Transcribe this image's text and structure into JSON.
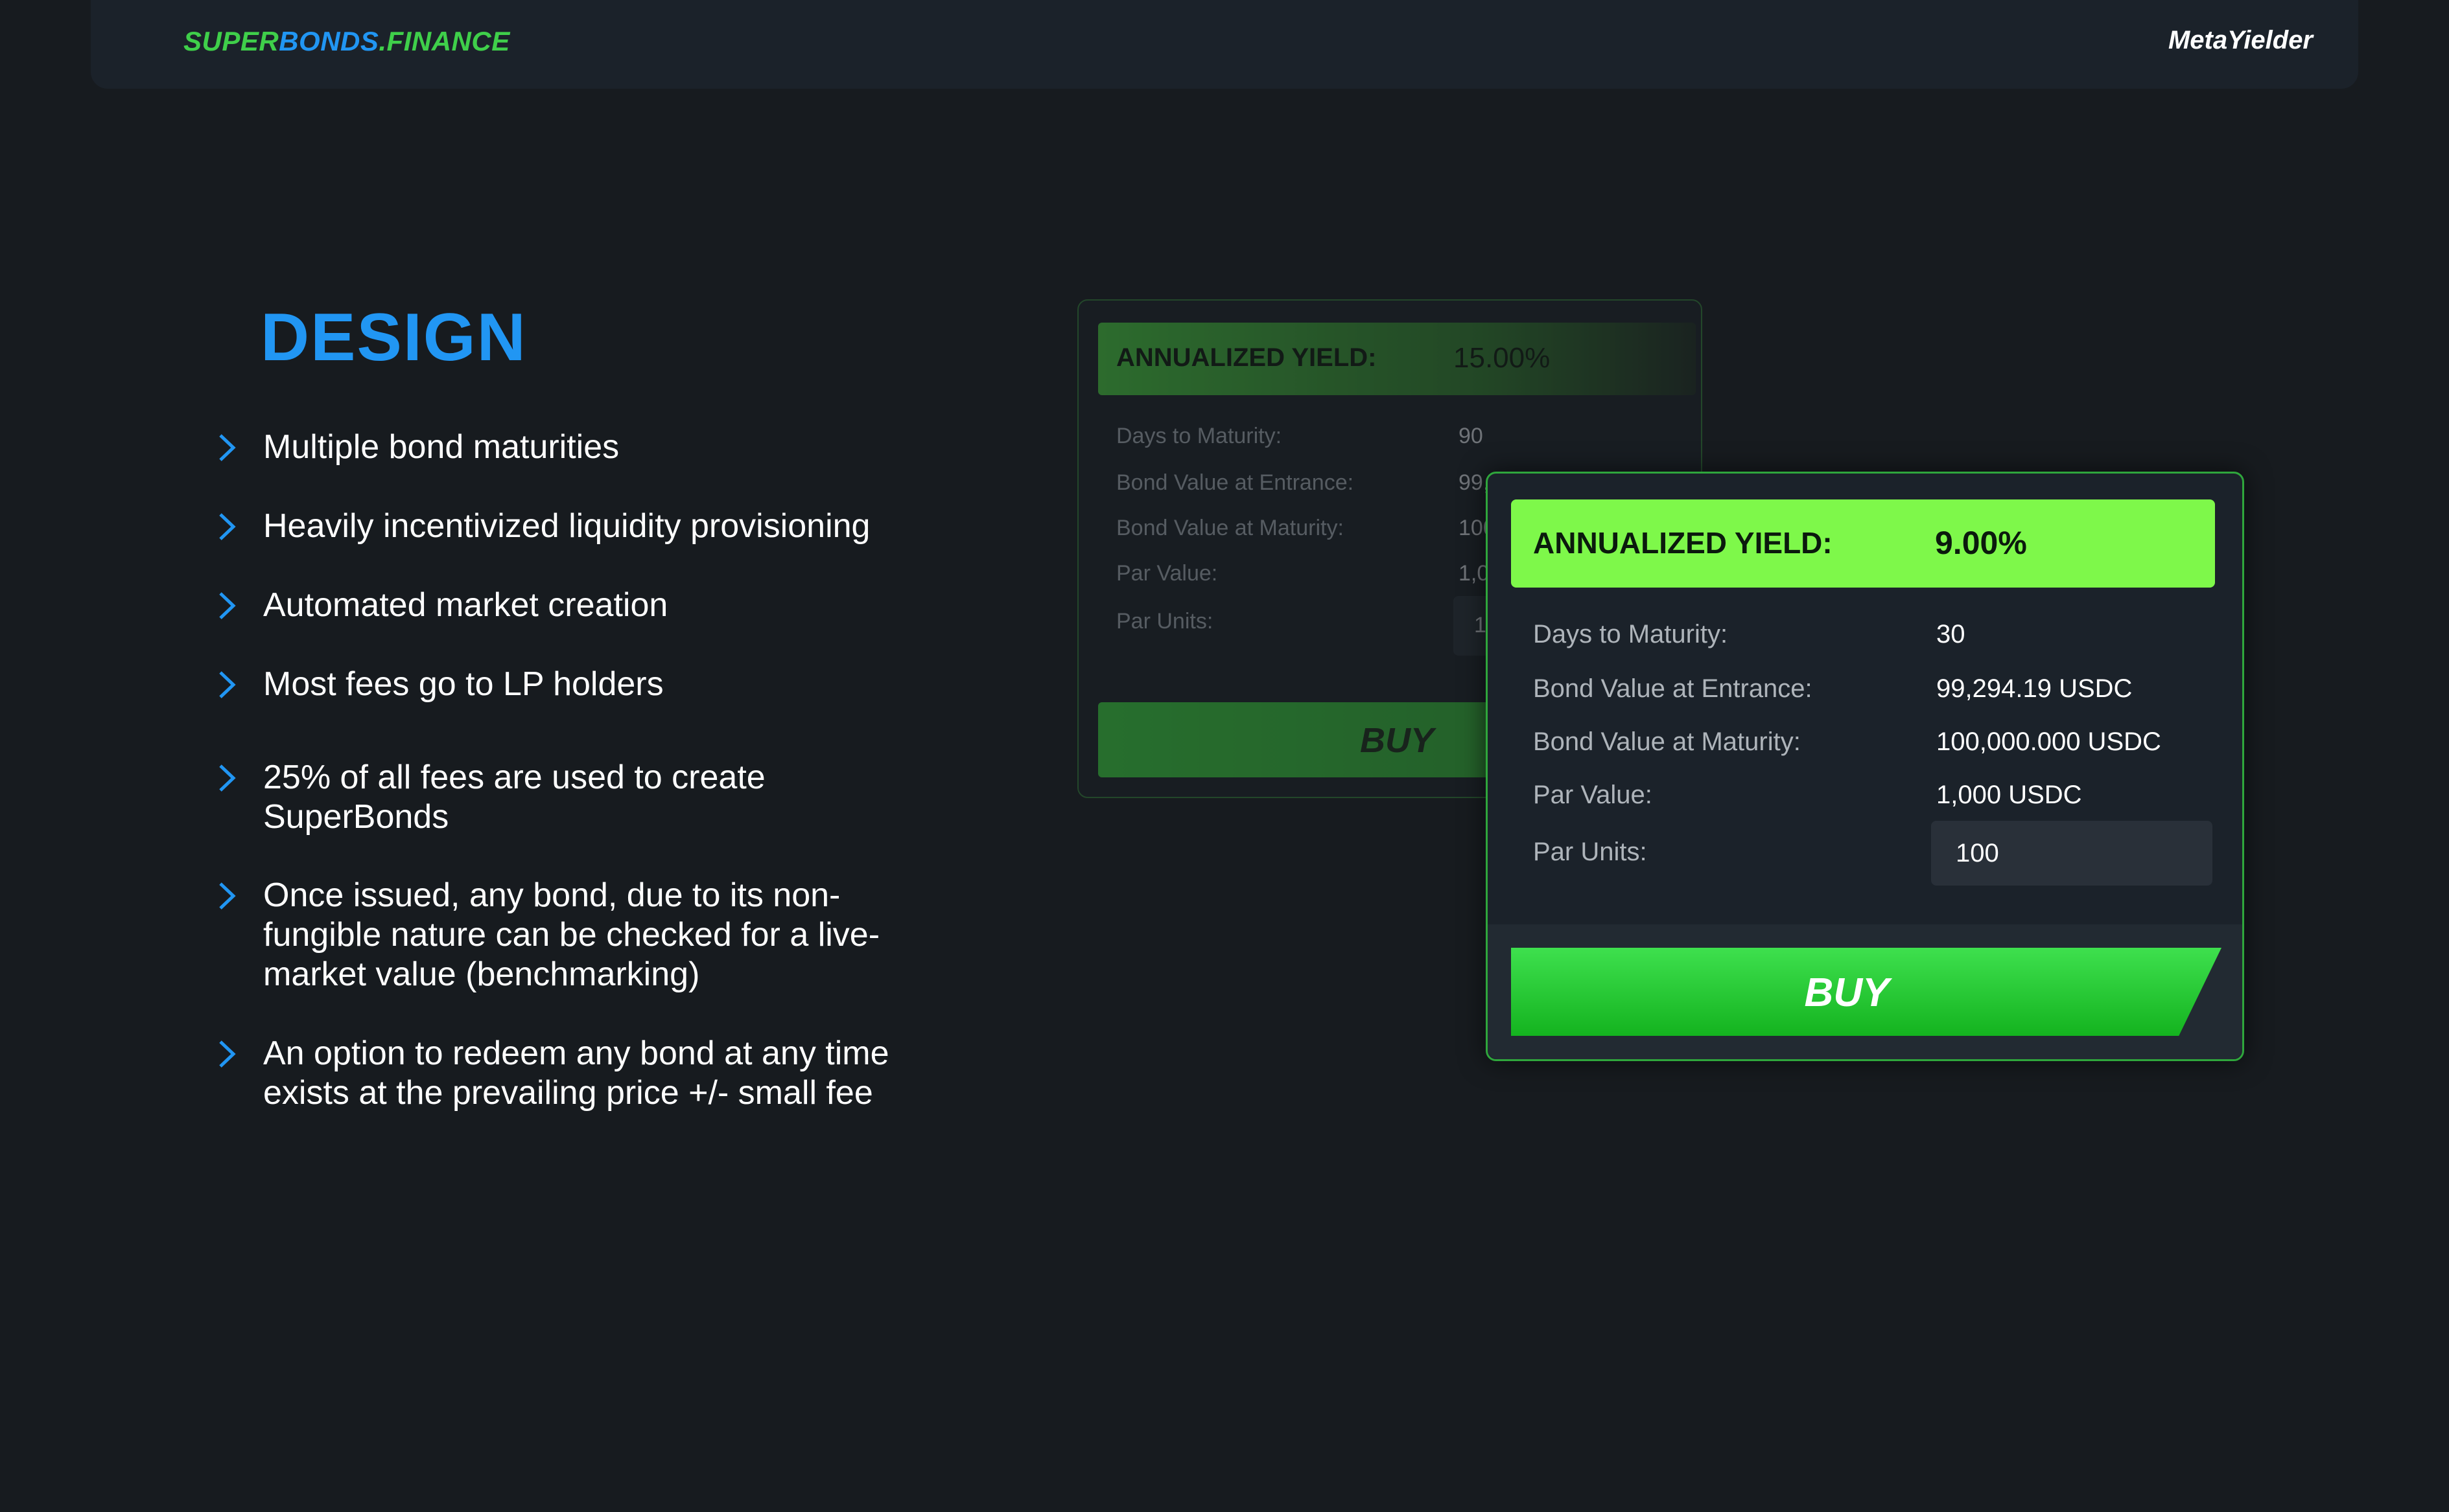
{
  "header": {
    "brand": {
      "part1": "SUPER",
      "part2": "BONDS",
      "part3": ".FINANCE"
    },
    "partner": "MetaYielder"
  },
  "slide": {
    "heading": "DESIGN",
    "bullets": [
      "Multiple bond maturities",
      "Heavily incentivized liquidity provisioning",
      "Automated market creation",
      "Most fees go to LP holders",
      "25% of all fees are used to create SuperBonds",
      "Once issued, any bond, due to its non-fungible nature can be checked for a live-market value (benchmarking)",
      "An option to redeem any bond at any time exists at the prevailing price +/- small fee"
    ]
  },
  "card_back": {
    "yield_label": "ANNUALIZED YIELD:",
    "yield_value": "15.00%",
    "rows": [
      {
        "label": "Days to Maturity:",
        "value": "90"
      },
      {
        "label": "Bond Value at Entrance:",
        "value": "99,"
      },
      {
        "label": "Bond Value at Maturity:",
        "value": "100"
      },
      {
        "label": "Par Value:",
        "value": "1,0"
      },
      {
        "label": "Par Units:",
        "value": "1"
      }
    ],
    "buy_label": "BUY"
  },
  "card_front": {
    "yield_label": "ANNUALIZED YIELD:",
    "yield_value": "9.00%",
    "rows": [
      {
        "label": "Days to Maturity:",
        "value": "30"
      },
      {
        "label": "Bond Value at Entrance:",
        "value": "99,294.19 USDC"
      },
      {
        "label": "Bond Value at Maturity:",
        "value": "100,000.000 USDC"
      },
      {
        "label": "Par Value:",
        "value": "1,000 USDC"
      },
      {
        "label": "Par Units:",
        "value": "100"
      }
    ],
    "buy_label": "BUY"
  },
  "colors": {
    "background": "#171b1f",
    "accent_blue": "#2196f3",
    "accent_green": "#3fcf4a",
    "yield_green": "#7ef84a"
  },
  "icons": {
    "bullet": "chevron-right-icon"
  }
}
